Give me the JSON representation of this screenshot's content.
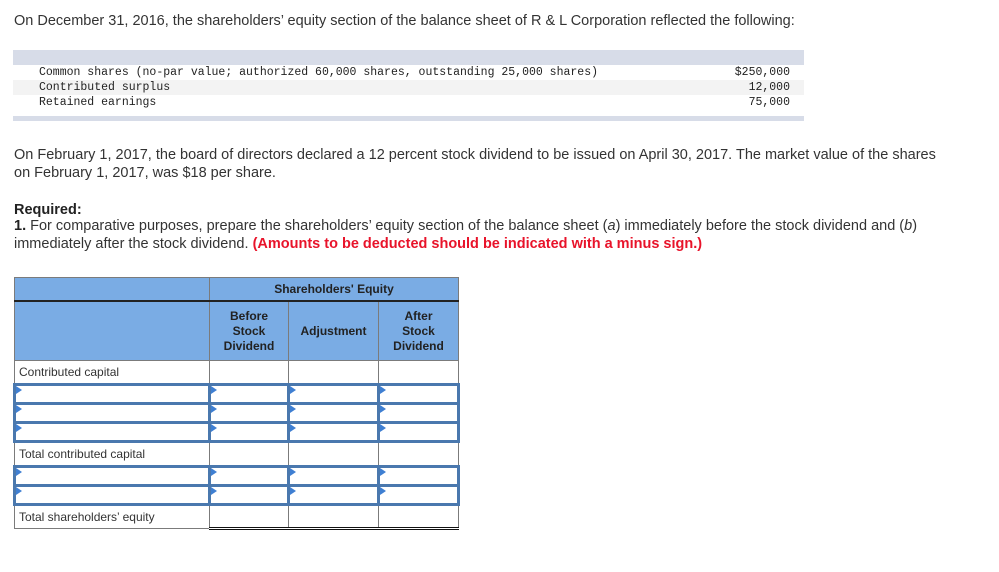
{
  "intro": "On December 31, 2016, the shareholders’ equity section of the balance sheet of R & L Corporation reflected the following:",
  "given_table": {
    "rows": [
      {
        "label": "Common shares (no-par value; authorized 60,000 shares, outstanding 25,000 shares)",
        "value": "$250,000"
      },
      {
        "label": "Contributed surplus",
        "value": "12,000"
      },
      {
        "label": "Retained earnings",
        "value": "75,000"
      }
    ]
  },
  "paragraph2": "On February 1, 2017, the board of directors declared a 12 percent stock dividend to be issued on April 30, 2017. The market value of the shares on February 1, 2017, was $18 per share.",
  "required": {
    "heading": "Required:",
    "number": "1.",
    "text_1": " For comparative purposes, prepare the shareholders’ equity section of the balance sheet (",
    "a": "a",
    "text_2": ") immediately before the stock dividend and (",
    "b": "b",
    "text_3": ") immediately after the stock dividend. ",
    "instruction": "(Amounts to be deducted should be indicated with a minus sign.)"
  },
  "worksheet": {
    "group_header": "Shareholders' Equity",
    "columns": [
      "Before Stock Dividend",
      "Adjustment",
      "After Stock Dividend"
    ],
    "labels": {
      "contributed_capital": "Contributed capital",
      "total_contributed_capital": "Total contributed capital",
      "total_shareholders_equity": "Total shareholders’ equity"
    },
    "inputs": {
      "value": ""
    }
  }
}
